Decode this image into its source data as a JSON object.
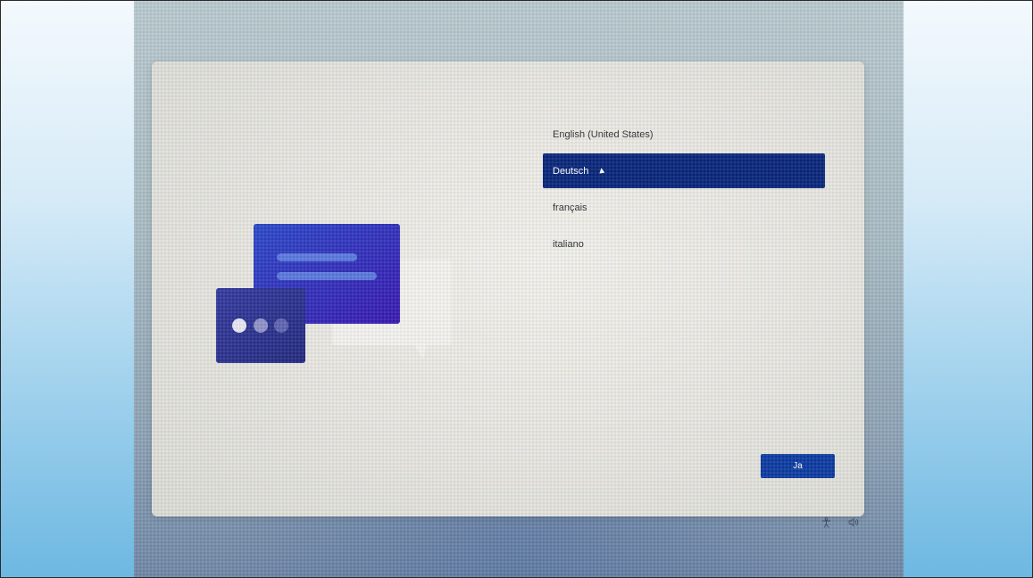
{
  "languages": {
    "items": [
      {
        "label": "English (United States)",
        "selected": false
      },
      {
        "label": "Deutsch",
        "selected": true
      },
      {
        "label": "français",
        "selected": false
      },
      {
        "label": "italiano",
        "selected": false
      }
    ]
  },
  "actions": {
    "confirm_label": "Ja"
  },
  "icons": {
    "accessibility": "accessibility-icon",
    "volume": "volume-icon",
    "cursor": "mouse-cursor-icon",
    "illustration": "language-chat-illustration"
  },
  "colors": {
    "selected_background": "#07257a",
    "button_background": "#0b3aa0",
    "card_background": "#ebeae5"
  }
}
